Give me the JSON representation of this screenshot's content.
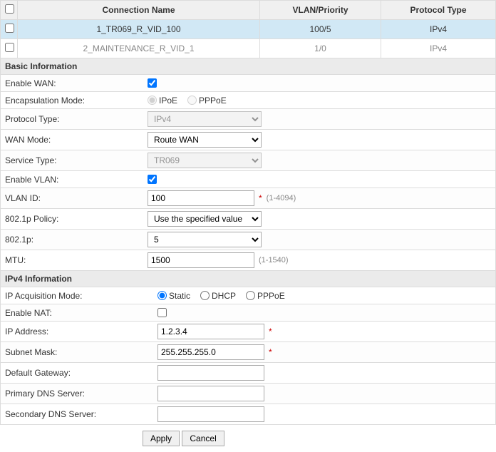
{
  "table": {
    "headers": {
      "name": "Connection Name",
      "vlan": "VLAN/Priority",
      "proto": "Protocol Type"
    },
    "rows": [
      {
        "name": "1_TR069_R_VID_100",
        "vlan": "100/5",
        "proto": "IPv4",
        "selected": true
      },
      {
        "name": "2_MAINTENANCE_R_VID_1",
        "vlan": "1/0",
        "proto": "IPv4",
        "selected": false
      }
    ]
  },
  "sections": {
    "basic": "Basic Information",
    "ipv4": "IPv4 Information"
  },
  "labels": {
    "enable_wan": "Enable WAN:",
    "encap": "Encapsulation Mode:",
    "proto_type": "Protocol Type:",
    "wan_mode": "WAN Mode:",
    "service_type": "Service Type:",
    "enable_vlan": "Enable VLAN:",
    "vlan_id": "VLAN ID:",
    "dot1p_policy": "802.1p Policy:",
    "dot1p": "802.1p:",
    "mtu": "MTU:",
    "ip_acq": "IP Acquisition Mode:",
    "enable_nat": "Enable NAT:",
    "ip_addr": "IP Address:",
    "subnet": "Subnet Mask:",
    "gateway": "Default Gateway:",
    "dns1": "Primary DNS Server:",
    "dns2": "Secondary DNS Server:"
  },
  "options": {
    "encap": {
      "ipoe": "IPoE",
      "pppoe": "PPPoE"
    },
    "proto_type": "IPv4",
    "wan_mode": "Route WAN",
    "service_type": "TR069",
    "dot1p_policy": "Use the specified value",
    "dot1p": "5",
    "ip_acq": {
      "static": "Static",
      "dhcp": "DHCP",
      "pppoe": "PPPoE"
    }
  },
  "values": {
    "enable_wan": true,
    "encap": "ipoe",
    "enable_vlan": true,
    "vlan_id": "100",
    "mtu": "1500",
    "ip_acq": "static",
    "enable_nat": false,
    "ip_addr": "1.2.3.4",
    "subnet": "255.255.255.0",
    "gateway": "",
    "dns1": "",
    "dns2": ""
  },
  "hints": {
    "vlan_id": "(1-4094)",
    "mtu": "(1-1540)",
    "req": "*"
  },
  "buttons": {
    "apply": "Apply",
    "cancel": "Cancel"
  }
}
